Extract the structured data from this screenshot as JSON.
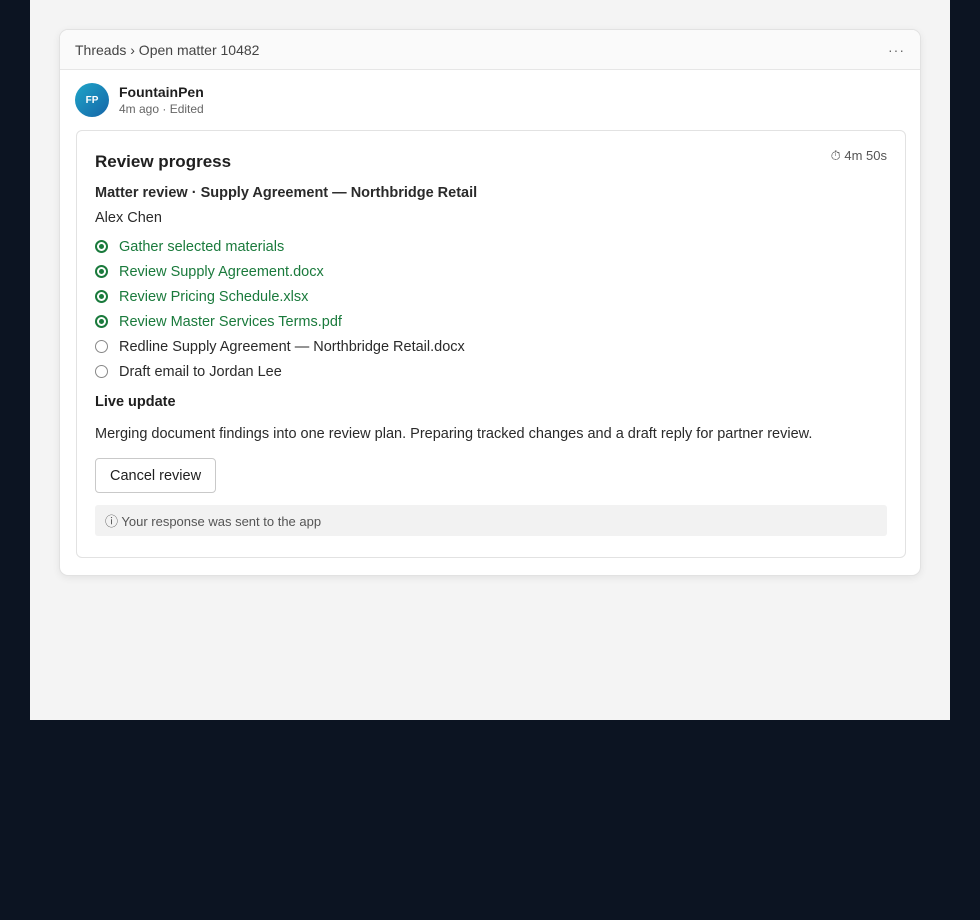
{
  "header": {
    "breadcrumb": "Threads › Open matter 10482",
    "more_icon": "···"
  },
  "author": {
    "initials": "FP",
    "name": "FountainPen",
    "meta": "4m ago · Edited"
  },
  "card": {
    "title": "Review progress",
    "timer": "⏱ 4m 50s",
    "subtitle": "Matter review · Supply Agreement — Northbridge Retail",
    "person": "Alex Chen",
    "steps": [
      {
        "label": "Gather selected materials",
        "status": "done"
      },
      {
        "label": "Review Supply Agreement.docx",
        "status": "done"
      },
      {
        "label": "Review Pricing Schedule.xlsx",
        "status": "done"
      },
      {
        "label": "Review Master Services Terms.pdf",
        "status": "done"
      },
      {
        "label": "Redline Supply Agreement — Northbridge Retail.docx",
        "status": "pending"
      },
      {
        "label": "Draft email to Jordan Lee",
        "status": "pending"
      }
    ],
    "live_title": "Live update",
    "live_text": "Merging document findings into one review plan. Preparing tracked changes and a draft reply for partner review.",
    "cancel_label": "Cancel review",
    "notice": "ⓘ Your response was sent to the app"
  },
  "colors": {
    "page_bg": "#0c1422",
    "app_bg": "#f4f4f4",
    "done_green": "#1a7a3c",
    "avatar_start": "#1fa5c8",
    "avatar_end": "#1565a8"
  }
}
